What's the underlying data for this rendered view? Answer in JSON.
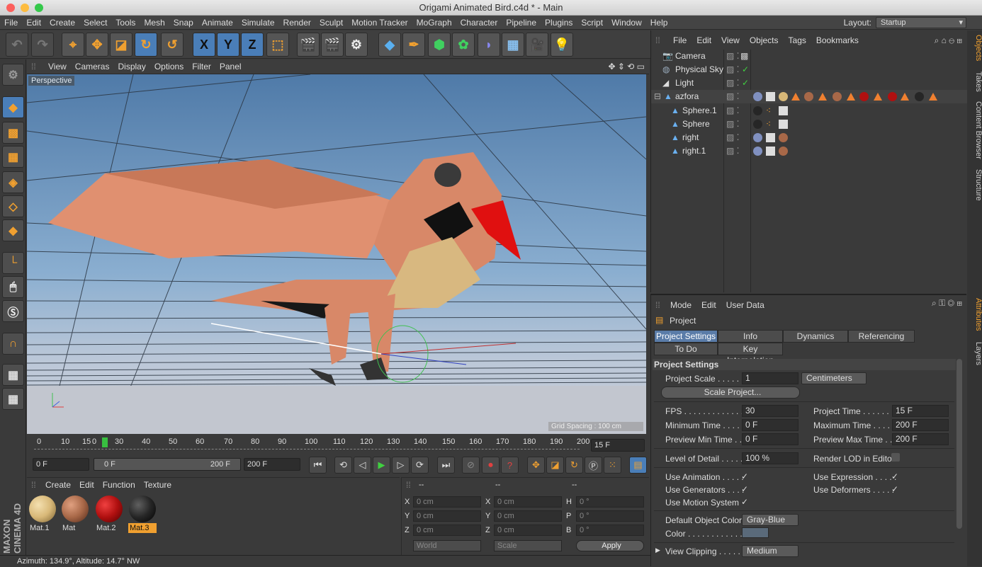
{
  "window": {
    "title": "Origami Animated Bird.c4d * - Main"
  },
  "menubar": {
    "items": [
      "File",
      "Edit",
      "Create",
      "Select",
      "Tools",
      "Mesh",
      "Snap",
      "Animate",
      "Simulate",
      "Render",
      "Sculpt",
      "Motion Tracker",
      "MoGraph",
      "Character",
      "Pipeline",
      "Plugins",
      "Script",
      "Window",
      "Help"
    ],
    "layout_label": "Layout:",
    "layout_value": "Startup"
  },
  "toolbar": {
    "axis_x": "X",
    "axis_y": "Y",
    "axis_z": "Z"
  },
  "viewport": {
    "menu": [
      "View",
      "Cameras",
      "Display",
      "Options",
      "Filter",
      "Panel"
    ],
    "label": "Perspective",
    "grid_spacing": "Grid Spacing : 100 cm"
  },
  "timeline": {
    "ticks": [
      "0",
      "10",
      "15",
      "0",
      "30",
      "40",
      "50",
      "60",
      "70",
      "80",
      "90",
      "100",
      "110",
      "120",
      "130",
      "140",
      "150",
      "160",
      "170",
      "180",
      "190",
      "200"
    ],
    "current_frame": "15 F",
    "start": "0 F",
    "range_start": "0 F",
    "range_end": "200 F",
    "end": "200 F"
  },
  "materials": {
    "menu": [
      "Create",
      "Edit",
      "Function",
      "Texture"
    ],
    "items": [
      {
        "name": "Mat.1",
        "color": "#d8b878"
      },
      {
        "name": "Mat",
        "color": "#a86848"
      },
      {
        "name": "Mat.2",
        "color": "#b01010"
      },
      {
        "name": "Mat.3",
        "color": "#262626"
      }
    ]
  },
  "coordinates": {
    "headers": [
      "--",
      "--",
      "--"
    ],
    "x": "0 cm",
    "y": "0 cm",
    "z": "0 cm",
    "sx": "0 cm",
    "sy": "0 cm",
    "sz": "0 cm",
    "h": "0 °",
    "p": "0 °",
    "b": "0 °",
    "labels": {
      "x": "X",
      "y": "Y",
      "z": "Z",
      "h": "H",
      "p": "P",
      "b": "B"
    },
    "mode": "World",
    "scale": "Scale",
    "apply": "Apply"
  },
  "status": "Azimuth: 134.9°, Altitude: 14.7°  NW",
  "brand": "MAXON CINEMA 4D",
  "objects_panel": {
    "menu": [
      "File",
      "Edit",
      "View",
      "Objects",
      "Tags",
      "Bookmarks"
    ],
    "rows": [
      {
        "name": "Camera"
      },
      {
        "name": "Physical Sky"
      },
      {
        "name": "Light"
      },
      {
        "name": "azfora"
      },
      {
        "name": "Sphere.1"
      },
      {
        "name": "Sphere"
      },
      {
        "name": "right"
      },
      {
        "name": "right.1"
      }
    ],
    "side_tabs": [
      "Objects",
      "Takes",
      "Content Browser",
      "Structure"
    ]
  },
  "attributes": {
    "menu": [
      "Mode",
      "Edit",
      "User Data"
    ],
    "object": "Project",
    "tabs": [
      "Project Settings",
      "Info",
      "Dynamics",
      "Referencing",
      "To Do",
      "Key Interpolation"
    ],
    "section": "Project Settings",
    "project_scale_label": "Project Scale . . . . .",
    "project_scale": "1",
    "project_scale_unit": "Centimeters",
    "scale_project": "Scale Project...",
    "fps_label": "FPS . . . . . . . . . . . . .",
    "fps": "30",
    "project_time_label": "Project Time . . . . . . .",
    "project_time": "15 F",
    "min_time_label": "Minimum Time . . . .",
    "min_time": "0 F",
    "max_time_label": "Maximum Time . . . .",
    "max_time": "200 F",
    "prev_min_label": "Preview Min Time . .",
    "prev_min": "0 F",
    "prev_max_label": "Preview Max Time . .",
    "prev_max": "200 F",
    "lod_label": "Level of Detail . . . . .",
    "lod": "100 %",
    "render_lod_label": "Render LOD in Editor",
    "use_anim": "Use Animation . . . . .",
    "use_expr": "Use Expression . . . . .",
    "use_gen": "Use Generators . . . .",
    "use_def": "Use Deformers . . . . .",
    "use_motion": "Use Motion System",
    "default_color_label": "Default Object Color",
    "default_color": "Gray-Blue",
    "color_label": "Color . . . . . . . . . . . .",
    "view_clip_label": "View Clipping . . . . .",
    "view_clip": "Medium",
    "side_tabs": [
      "Attributes",
      "Layers"
    ]
  }
}
